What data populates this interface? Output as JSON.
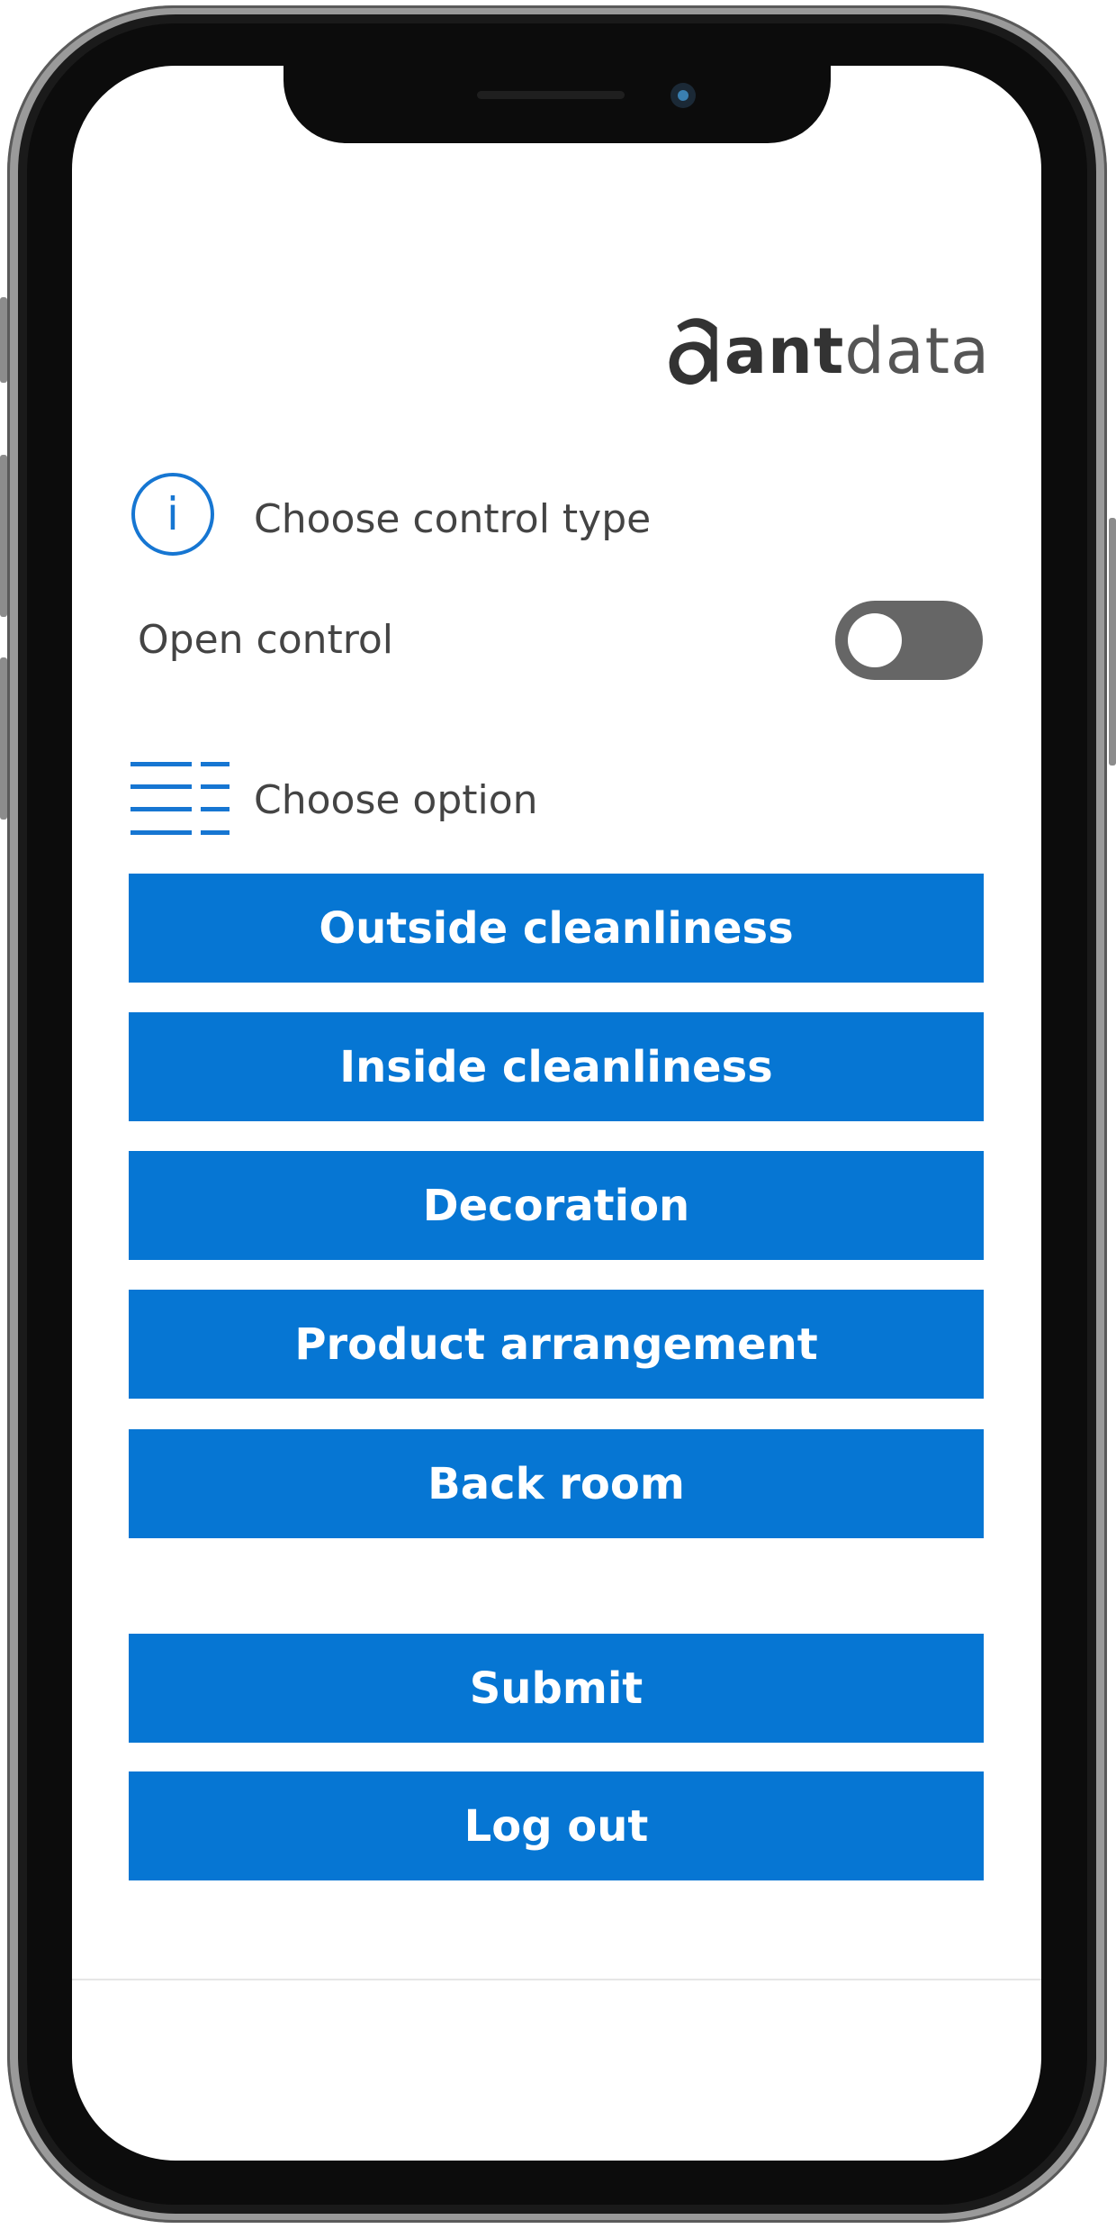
{
  "brand": {
    "logo_text_bold": "ant",
    "logo_text_light": "data",
    "accent_color": "#0676d3"
  },
  "control_type": {
    "icon": "info-icon",
    "icon_glyph": "i",
    "label": "Choose control type"
  },
  "open_control": {
    "label": "Open control",
    "toggle_on": false
  },
  "options": {
    "icon": "list-icon",
    "label": "Choose option",
    "buttons": [
      "Outside cleanliness",
      "Inside cleanliness",
      "Decoration",
      "Product arrangement",
      "Back room"
    ]
  },
  "actions": {
    "submit": "Submit",
    "logout": "Log out"
  }
}
